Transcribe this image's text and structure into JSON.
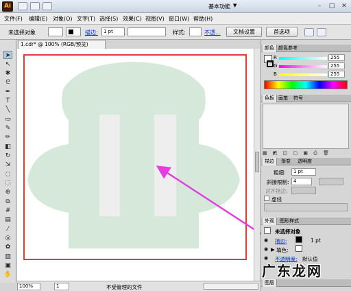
{
  "app": {
    "logo": "Ai",
    "workspace": "基本功能",
    "window_controls": [
      "–",
      "□",
      "✕"
    ]
  },
  "menu": [
    "文件(F)",
    "编辑(E)",
    "对象(O)",
    "文字(T)",
    "选择(S)",
    "效果(C)",
    "视图(V)",
    "窗口(W)",
    "帮助(H)"
  ],
  "control": {
    "selection": "未选择对象",
    "stroke_label": "描边:",
    "stroke_value": "1 pt",
    "style_label": "样式:",
    "opacity_label": "不透...",
    "doc_setup": "文档设置",
    "preferences": "首选项"
  },
  "document": {
    "tab": "1.cdr* @ 100% (RGB/预览)"
  },
  "status": {
    "zoom": "100%",
    "page": "1",
    "message": "不受管理的文件"
  },
  "color_panel": {
    "tabs": [
      "颜色",
      "颜色参考"
    ],
    "channels": [
      {
        "label": "R",
        "value": "255"
      },
      {
        "label": "G",
        "value": "255"
      },
      {
        "label": "B",
        "value": "255"
      }
    ]
  },
  "swatch_panel": {
    "tabs": [
      "色板",
      "画笔",
      "符号"
    ]
  },
  "stroke_panel": {
    "tabs": [
      "描边",
      "渐变",
      "透明度"
    ],
    "weight_label": "粗细:",
    "weight_value": "1 pt",
    "miter_label": "斜接限制:",
    "miter_value": "4",
    "align_label": "对齐描边:",
    "dashed_label": "虚线"
  },
  "appearance_panel": {
    "tabs": [
      "外观",
      "图形样式"
    ],
    "title": "未选择对象",
    "stroke_label": "描边:",
    "stroke_value": "1 pt",
    "fill_label": "填色:",
    "opacity_label": "不透明度:",
    "opacity_value": "默认值"
  },
  "layers_panel": {
    "tab": "图层"
  },
  "watermark": "广东龙网",
  "colors": {
    "shape_fill": "#d5e8d9",
    "artboard_border": "#e03a3a",
    "arrow": "#e43de0",
    "slot": "#eeeeee"
  }
}
